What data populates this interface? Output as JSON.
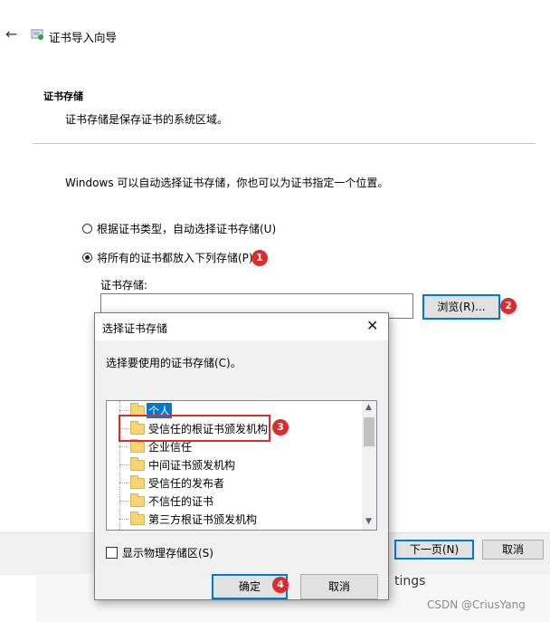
{
  "wizard": {
    "title": "证书导入向导",
    "section_title": "证书存储",
    "section_desc": "证书存储是保存证书的系统区域。",
    "intro": "Windows 可以自动选择证书存储，你也可以为证书指定一个位置。",
    "radio_auto": "根据证书类型，自动选择证书存储(U)",
    "radio_manual": "将所有的证书都放入下列存储(P)",
    "store_label": "证书存储:",
    "store_value": "",
    "browse_button": "浏览(R)...",
    "next_button": "下一页(N)",
    "cancel_button": "取消",
    "partial_text": "tings"
  },
  "badges": [
    "1",
    "2",
    "3",
    "4"
  ],
  "dialog": {
    "title": "选择证书存储",
    "close_glyph": "✕",
    "prompt": "选择要使用的证书存储(C)。",
    "tree_items": [
      "个人",
      "受信任的根证书颁发机构",
      "企业信任",
      "中间证书颁发机构",
      "受信任的发布者",
      "不信任的证书",
      "第三方根证书颁发机构"
    ],
    "selected_index": 0,
    "show_physical_label": "显示物理存储区(S)",
    "ok_button": "确定",
    "cancel_button": "取消"
  },
  "watermark": "CSDN @CriusYang",
  "colors": {
    "accent": "#0078d7",
    "annotation_red": "#e02b2b"
  }
}
